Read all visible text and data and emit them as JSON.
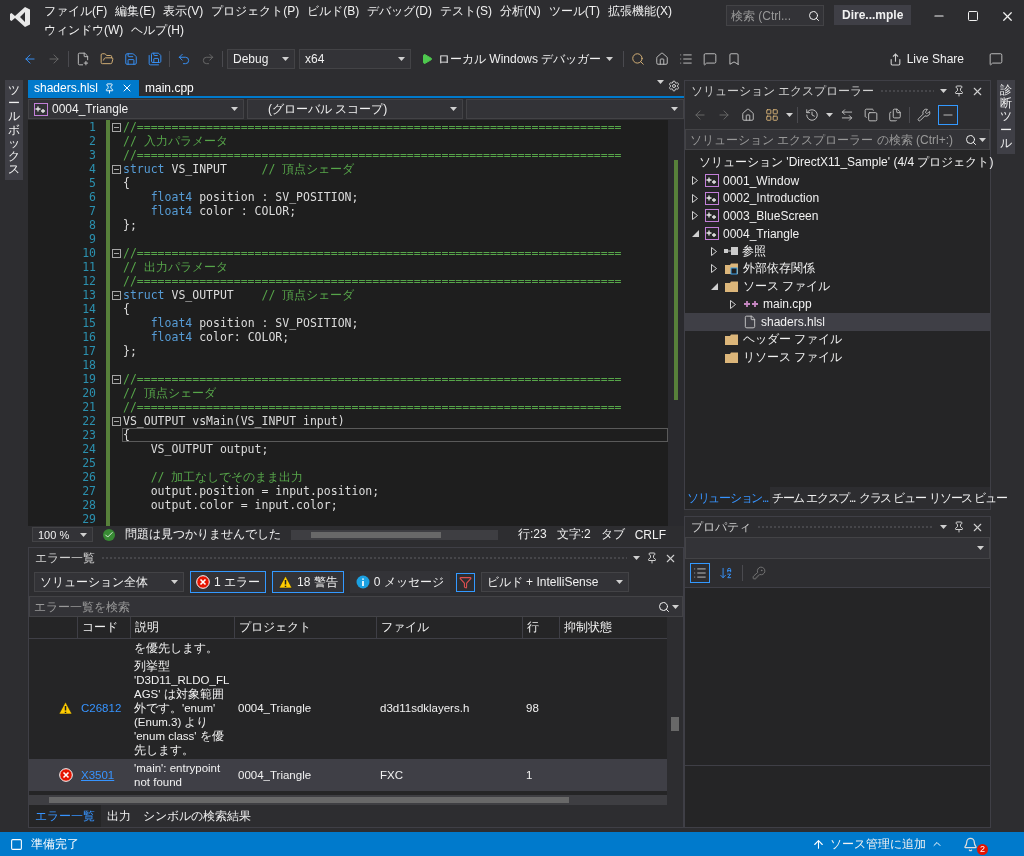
{
  "title_bar": {
    "menu": [
      "ファイル(F)",
      "編集(E)",
      "表示(V)",
      "プロジェクト(P)",
      "ビルド(B)",
      "デバッグ(D)",
      "テスト(S)",
      "分析(N)",
      "ツール(T)",
      "拡張機能(X)",
      "ウィンドウ(W)",
      "ヘルプ(H)"
    ],
    "search": {
      "placeholder": "検索 (Ctrl..."
    },
    "title": "Dire...mple"
  },
  "toolbar": {
    "configuration": "Debug",
    "platform": "x64",
    "run": "ローカル Windows デバッガー",
    "live_share": "Live Share"
  },
  "toolbox": "ツールボックス",
  "diagnostics": "診断ツール",
  "editor": {
    "tabs": [
      {
        "label": "shaders.hlsl",
        "selected": true
      },
      {
        "label": "main.cpp",
        "selected": false
      }
    ],
    "navigation": {
      "project": "0004_Triangle",
      "scope": "(グローバル スコープ)"
    },
    "lines": [
      {
        "number": "1",
        "fold": true,
        "current": false,
        "tokens": [
          {
            "kind": "comment",
            "text": "//======================================================================"
          }
        ]
      },
      {
        "number": "2",
        "fold": false,
        "current": false,
        "tokens": [
          {
            "kind": "comment",
            "text": "// 入力パラメータ"
          }
        ]
      },
      {
        "number": "3",
        "fold": false,
        "current": false,
        "tokens": [
          {
            "kind": "comment",
            "text": "//======================================================================"
          }
        ]
      },
      {
        "number": "4",
        "fold": true,
        "current": false,
        "tokens": [
          {
            "kind": "keyword",
            "text": "struct"
          },
          {
            "kind": "plain",
            "text": " VS_INPUT     "
          },
          {
            "kind": "comment",
            "text": "// 頂点シェーダ"
          }
        ]
      },
      {
        "number": "5",
        "fold": false,
        "current": false,
        "tokens": [
          {
            "kind": "plain",
            "text": "{"
          }
        ]
      },
      {
        "number": "6",
        "fold": false,
        "current": false,
        "tokens": [
          {
            "kind": "keyword",
            "text": "    float4"
          },
          {
            "kind": "plain",
            "text": " position : SV_POSITION;"
          }
        ]
      },
      {
        "number": "7",
        "fold": false,
        "current": false,
        "tokens": [
          {
            "kind": "keyword",
            "text": "    float4"
          },
          {
            "kind": "plain",
            "text": " color : COLOR;"
          }
        ]
      },
      {
        "number": "8",
        "fold": false,
        "current": false,
        "tokens": [
          {
            "kind": "plain",
            "text": "};"
          }
        ]
      },
      {
        "number": "9",
        "fold": false,
        "current": false
      },
      {
        "number": "10",
        "fold": true,
        "current": false,
        "tokens": [
          {
            "kind": "comment",
            "text": "//======================================================================"
          }
        ]
      },
      {
        "number": "11",
        "fold": false,
        "current": false,
        "tokens": [
          {
            "kind": "comment",
            "text": "// 出力パラメータ"
          }
        ]
      },
      {
        "number": "12",
        "fold": false,
        "current": false,
        "tokens": [
          {
            "kind": "comment",
            "text": "//======================================================================"
          }
        ]
      },
      {
        "number": "13",
        "fold": true,
        "current": false,
        "tokens": [
          {
            "kind": "keyword",
            "text": "struct"
          },
          {
            "kind": "plain",
            "text": " VS_OUTPUT    "
          },
          {
            "kind": "comment",
            "text": "// 頂点シェーダ"
          }
        ]
      },
      {
        "number": "14",
        "fold": false,
        "current": false,
        "tokens": [
          {
            "kind": "plain",
            "text": "{"
          }
        ]
      },
      {
        "number": "15",
        "fold": false,
        "current": false,
        "tokens": [
          {
            "kind": "keyword",
            "text": "    float4"
          },
          {
            "kind": "plain",
            "text": " position : SV_POSITION;"
          }
        ]
      },
      {
        "number": "16",
        "fold": false,
        "current": false,
        "tokens": [
          {
            "kind": "keyword",
            "text": "    float4"
          },
          {
            "kind": "plain",
            "text": " color: COLOR;"
          }
        ]
      },
      {
        "number": "17",
        "fold": false,
        "current": false,
        "tokens": [
          {
            "kind": "plain",
            "text": "};"
          }
        ]
      },
      {
        "number": "18",
        "fold": false,
        "current": false
      },
      {
        "number": "19",
        "fold": true,
        "current": false,
        "tokens": [
          {
            "kind": "comment",
            "text": "//======================================================================"
          }
        ]
      },
      {
        "number": "20",
        "fold": false,
        "current": false,
        "tokens": [
          {
            "kind": "comment",
            "text": "// 頂点シェーダ"
          }
        ]
      },
      {
        "number": "21",
        "fold": false,
        "current": false,
        "tokens": [
          {
            "kind": "comment",
            "text": "//======================================================================"
          }
        ]
      },
      {
        "number": "22",
        "fold": true,
        "current": false,
        "tokens": [
          {
            "kind": "plain",
            "text": "VS_OUTPUT vsMain(VS_INPUT input)"
          }
        ]
      },
      {
        "number": "23",
        "fold": false,
        "current": true,
        "tokens": [
          {
            "kind": "plain",
            "text": "{"
          }
        ]
      },
      {
        "number": "24",
        "fold": false,
        "current": false,
        "tokens": [
          {
            "kind": "plain",
            "text": "    VS_OUTPUT output;"
          }
        ]
      },
      {
        "number": "25",
        "fold": false,
        "current": false
      },
      {
        "number": "26",
        "fold": false,
        "current": false,
        "tokens": [
          {
            "kind": "comment",
            "text": "    // 加工なしでそのまま出力"
          }
        ]
      },
      {
        "number": "27",
        "fold": false,
        "current": false,
        "tokens": [
          {
            "kind": "plain",
            "text": "    output.position = input.position;"
          }
        ]
      },
      {
        "number": "28",
        "fold": false,
        "current": false,
        "tokens": [
          {
            "kind": "plain",
            "text": "    output.color = input.color;"
          }
        ]
      },
      {
        "number": "29",
        "fold": false,
        "current": false
      }
    ],
    "status": {
      "zoom": "100 %",
      "issues": "問題は見つかりませんでした",
      "line": "行:23",
      "column": "文字:2",
      "indent": "タブ",
      "line_ending": "CRLF"
    }
  },
  "error_list": {
    "title": "エラー一覧",
    "scope": "ソリューション全体",
    "filters": [
      {
        "kind": "error",
        "label": "1 エラー",
        "selected": true
      },
      {
        "kind": "warning",
        "label": "18 警告",
        "selected": true
      },
      {
        "kind": "info",
        "label": "0 メッセージ",
        "selected": false
      }
    ],
    "filter_toggle": {
      "selected": true
    },
    "source": "ビルド + IntelliSense",
    "search": {
      "placeholder": "エラー一覧を検索"
    },
    "columns": [
      "コード",
      "説明",
      "プロジェクト",
      "ファイル",
      "行",
      "抑制状態"
    ],
    "rows": [
      {
        "kind": "continuation",
        "description": "を優先します。",
        "selected": false
      },
      {
        "kind": "warning",
        "code": "C26812",
        "description": "列挙型 'D3D11_RLDO_FLAGS' は対象範囲外です。'enum' (Enum.3) より 'enum class' を優先します。",
        "project": "0004_Triangle",
        "file": "d3d11sdklayers.h",
        "line": "98",
        "selected": false
      },
      {
        "kind": "error",
        "code": "X3501",
        "description": "'main': entrypoint not found",
        "project": "0004_Triangle",
        "file": "FXC",
        "line": "1",
        "selected": true
      }
    ],
    "tabs": [
      {
        "label": "エラー一覧",
        "selected": true
      },
      {
        "label": "出力",
        "selected": false
      },
      {
        "label": "シンボルの検索結果",
        "selected": false
      }
    ]
  },
  "solution_explorer": {
    "title": "ソリューション エクスプローラー",
    "toolbar_toggle": {
      "selected": true
    },
    "search": {
      "placeholder": "ソリューション エクスプローラー の検索 (Ctrl+:)"
    },
    "tree": [
      {
        "kind": "solution",
        "label": "ソリューション 'DirectX11_Sample' (4/4 プロジェクト)",
        "selected": false,
        "children": [
          {
            "kind": "project",
            "label": "0001_Window",
            "expanded": false,
            "selected": false
          },
          {
            "kind": "project",
            "label": "0002_Introduction",
            "expanded": false,
            "selected": false
          },
          {
            "kind": "project",
            "label": "0003_BlueScreen",
            "expanded": false,
            "selected": false
          },
          {
            "kind": "project",
            "label": "0004_Triangle",
            "expanded": true,
            "selected": false,
            "children": [
              {
                "kind": "references",
                "label": "参照",
                "expanded": false,
                "selected": false
              },
              {
                "kind": "external",
                "label": "外部依存関係",
                "expanded": false,
                "selected": false
              },
              {
                "kind": "folder",
                "label": "ソース ファイル",
                "expanded": true,
                "selected": false,
                "children": [
                  {
                    "kind": "cpp",
                    "label": "main.cpp",
                    "expanded": false,
                    "selected": false
                  },
                  {
                    "kind": "file",
                    "label": "shaders.hlsl",
                    "selected": true
                  }
                ]
              },
              {
                "kind": "folder",
                "label": "ヘッダー ファイル",
                "selected": false
              },
              {
                "kind": "folder",
                "label": "リソース ファイル",
                "selected": false
              }
            ]
          }
        ]
      }
    ],
    "tabs": [
      {
        "label": "ソリューション...",
        "selected": true
      },
      {
        "label": "チーム エクスプ...",
        "selected": false
      },
      {
        "label": "クラス ビュー",
        "selected": false
      },
      {
        "label": "リソース ビュー",
        "selected": false
      }
    ]
  },
  "properties": {
    "title": "プロパティ",
    "view_buttons": [
      {
        "kind": "categorized",
        "selected": true
      },
      {
        "kind": "alphabetical",
        "selected": false
      }
    ]
  },
  "status_bar": {
    "message": "準備完了",
    "source_control": "ソース管理に追加",
    "notifications": "2"
  }
}
